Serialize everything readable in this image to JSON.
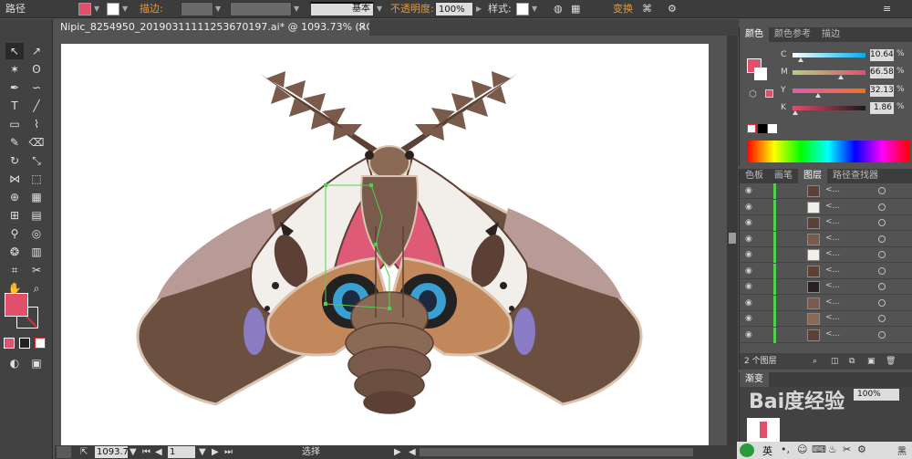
{
  "control_bar": {
    "object_type": "路径",
    "fill_color": "#e0506b",
    "stroke_label": "描边:",
    "stroke_style": "基本",
    "opacity_label": "不透明度:",
    "opacity_value": "100%",
    "style_label": "样式:",
    "transform_label": "变换"
  },
  "document": {
    "tab_title": "Nipic_8254950_20190311111253670197.ai* @ 1093.73% (RGB/预览)",
    "close_glyph": "×"
  },
  "status_bar": {
    "zoom": "1093.7",
    "artboard": "1",
    "tool": "选择"
  },
  "color_panel": {
    "tabs": [
      "颜色",
      "颜色参考",
      "描边"
    ],
    "sliders": [
      {
        "label": "C",
        "value": "10.64",
        "pct": "%",
        "pos": 0.88
      },
      {
        "label": "M",
        "value": "66.58",
        "pct": "%",
        "pos": 0.7
      },
      {
        "label": "Y",
        "value": "32.13",
        "pct": "%",
        "pos": 0.35
      },
      {
        "label": "K",
        "value": "1.86",
        "pct": "%",
        "pos": 0.04
      }
    ]
  },
  "layers_panel": {
    "tabs": [
      "色板",
      "画笔",
      "图层",
      "路径查找器"
    ],
    "layer_count": "2 个图层",
    "rows": [
      {
        "name": "<..."
      },
      {
        "name": "<..."
      },
      {
        "name": "<..."
      },
      {
        "name": "<..."
      },
      {
        "name": "<..."
      },
      {
        "name": "<..."
      },
      {
        "name": "<..."
      },
      {
        "name": "<..."
      },
      {
        "name": "<..."
      },
      {
        "name": "<..."
      },
      {
        "name": "<..."
      },
      {
        "name": "<..."
      },
      {
        "name": "<..."
      },
      {
        "name": "<..."
      },
      {
        "name": "<..."
      },
      {
        "name": "<..."
      },
      {
        "name": "<..."
      },
      {
        "name": "<..."
      },
      {
        "name": "<..."
      },
      {
        "name": "<..."
      }
    ]
  },
  "lower_panel": {
    "tab": "渐变",
    "value": "100%",
    "watermark": "Bai度经验"
  },
  "taskbar": {
    "ime": "英",
    "text": "黑"
  }
}
